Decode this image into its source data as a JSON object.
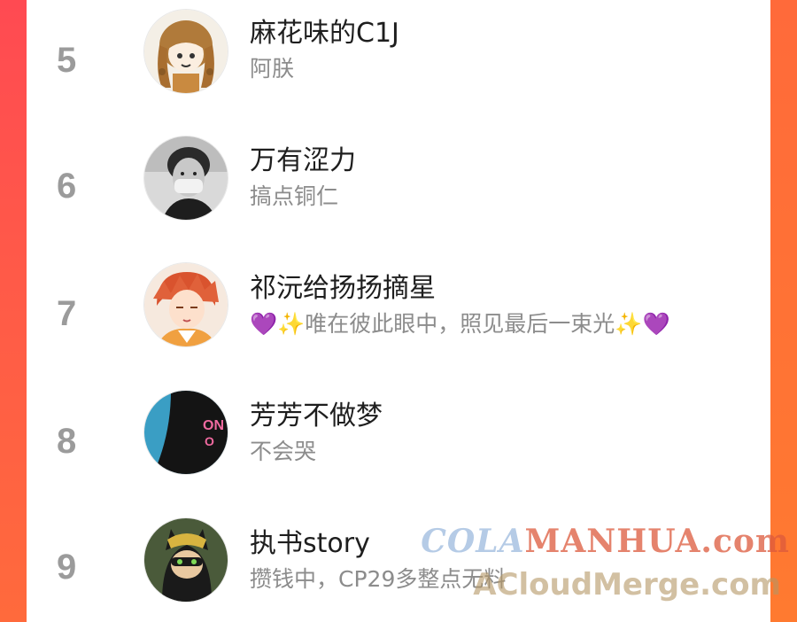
{
  "colors": {
    "background_accent": "#ff4a52",
    "rank_number": "#9b9b9b",
    "name_text": "#1e1e1e",
    "bio_text": "#8c8c8c"
  },
  "ranking": [
    {
      "rank": "5",
      "name": "麻花味的C1J",
      "bio": "阿朕",
      "avatar": "cartoon-girl-avatar"
    },
    {
      "rank": "6",
      "name": "万有涩力",
      "bio": "搞点铜仁",
      "avatar": "masked-man-avatar"
    },
    {
      "rank": "7",
      "name": "祁沅给扬扬摘星",
      "bio_parts": [
        "💜",
        "✨",
        "唯在彼此眼中，照见最后一束光",
        "✨",
        "💜"
      ],
      "avatar": "anime-redhead-avatar"
    },
    {
      "rank": "8",
      "name": "芳芳不做梦",
      "bio": "不会哭",
      "avatar": "teal-shirt-avatar"
    },
    {
      "rank": "9",
      "name": "执书story",
      "bio": "攒钱中，CP29多整点无料",
      "avatar": "cat-noir-avatar"
    }
  ],
  "watermark": {
    "line1_a": "COLA",
    "line1_b": "MANHUA.com",
    "line2": "ACloudMerge.com"
  }
}
